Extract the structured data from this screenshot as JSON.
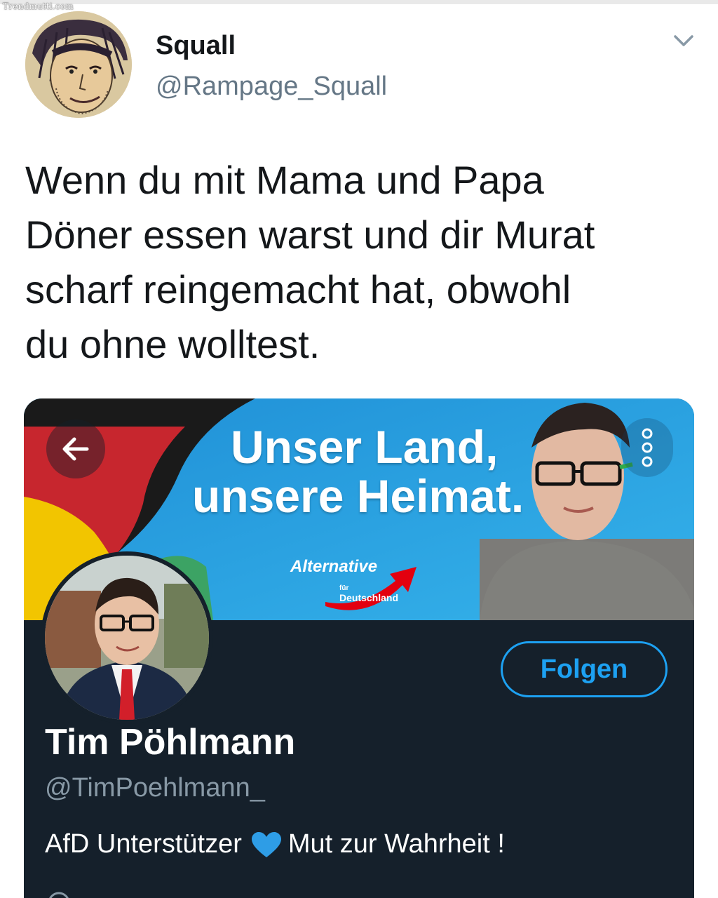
{
  "watermark": "Trendmutti.com",
  "author": {
    "name": "Squall",
    "handle": "@Rampage_Squall"
  },
  "tweet": {
    "lines": [
      "Wenn du mit Mama und Papa",
      "Döner essen warst und dir Murat",
      "scharf reingemacht hat, obwohl",
      "du ohne wolltest."
    ]
  },
  "embedded_profile": {
    "banner": {
      "slogan_line1": "Unser Land,",
      "slogan_line2": "unsere Heimat.",
      "party_logo_main": "Alternative",
      "party_logo_small": "für",
      "party_logo_country": "Deutschland"
    },
    "follow_label": "Folgen",
    "name": "Tim Pöhlmann",
    "handle": "@TimPoehlmann_",
    "bio_before": "AfD Unterstützer",
    "bio_after": "Mut zur Wahrheit !",
    "bio_icon": "blue-heart-icon"
  },
  "colors": {
    "card_bg": "#15202b",
    "accent": "#1da1f2",
    "banner_blue": "#2aa6e3"
  }
}
